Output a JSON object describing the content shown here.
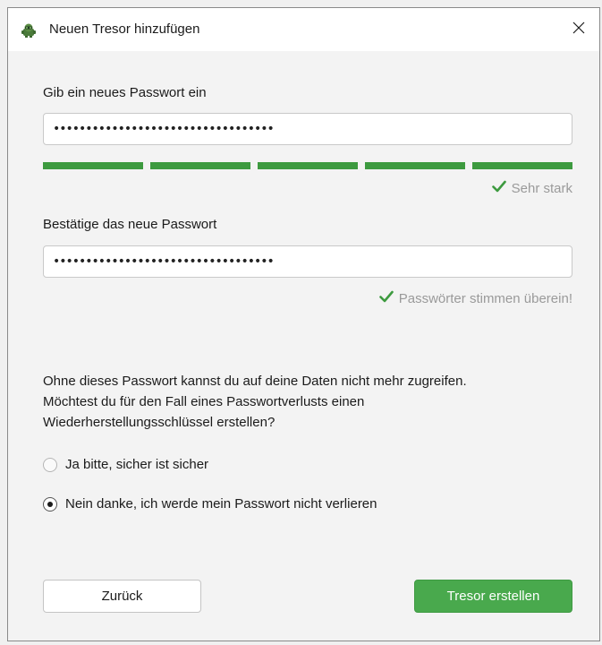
{
  "window": {
    "title": "Neuen Tresor hinzufügen",
    "app_icon": "cryptomator-bot-icon",
    "close_icon": "close-icon"
  },
  "form": {
    "new_password_label": "Gib ein neues Passwort ein",
    "new_password_value": "••••••••••••••••••••••••••••••••••",
    "strength": {
      "segments_filled": 5,
      "segments_total": 5,
      "color": "#3d9a3f"
    },
    "strength_text": "Sehr stark",
    "confirm_label": "Bestätige das neue Passwort",
    "confirm_value": "••••••••••••••••••••••••••••••••••",
    "match_text": "Passwörter stimmen überein!",
    "check_icon": "checkmark-icon",
    "check_color": "#3d9a3f"
  },
  "recovery": {
    "line1": "Ohne dieses Passwort kannst du auf deine Daten nicht mehr zugreifen.",
    "line2": "Möchtest du für den Fall eines Passwortverlusts einen",
    "line3": "Wiederherstellungsschlüssel erstellen?",
    "options": [
      {
        "label": "Ja bitte, sicher ist sicher",
        "selected": false
      },
      {
        "label": "Nein danke, ich werde mein Passwort nicht verlieren",
        "selected": true
      }
    ]
  },
  "buttons": {
    "back_label": "Zurück",
    "create_label": "Tresor erstellen",
    "create_color": "#49a94d"
  }
}
